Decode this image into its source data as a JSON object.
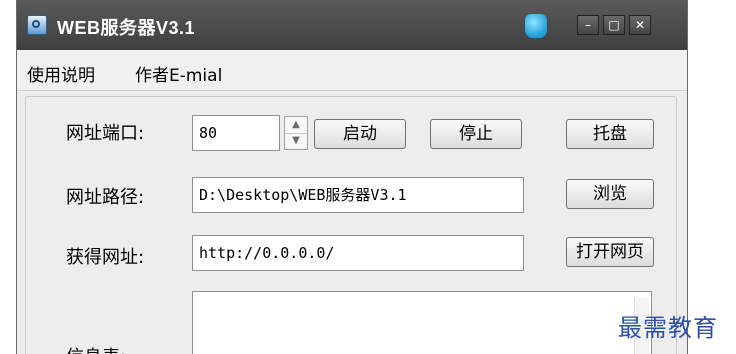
{
  "window": {
    "title": "WEB服务器V3.1",
    "controls": {
      "minimize": "–",
      "maximize": "□",
      "close": "✕"
    }
  },
  "menu": [
    "使用说明",
    "作者E-mial"
  ],
  "form": {
    "port": {
      "label": "网址端口:",
      "value": "80"
    },
    "buttons": {
      "start": "启动",
      "stop": "停止",
      "tray": "托盘",
      "browse": "浏览",
      "open": "打开网页"
    },
    "path": {
      "label": "网址路径:",
      "value": "D:\\Desktop\\WEB服务器V3.1"
    },
    "url": {
      "label": "获得网址:",
      "value": "http://0.0.0.0/"
    },
    "info": {
      "label": "信息表:"
    }
  },
  "watermark": "最需教育",
  "colors": {
    "titlebar": "#4a4a4a",
    "window_bg": "#ededed",
    "watermark": "#2d4fa6"
  },
  "icons": {
    "app": "server-icon",
    "shirt": "skin-icon",
    "spin_up": "up-arrow-icon",
    "spin_down": "down-arrow-icon"
  }
}
